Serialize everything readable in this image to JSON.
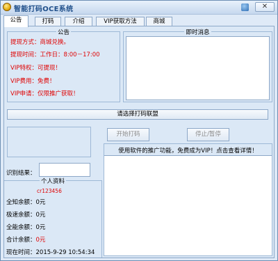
{
  "window": {
    "title": "智能打码OCE系统",
    "close_symbol": "✕"
  },
  "tabs": [
    "公告",
    "打码",
    "介绍",
    "VIP获取方法",
    "商城"
  ],
  "notice": {
    "title": "公告",
    "lines": [
      "提现方式：商城兑换。",
      "提现时间：工作日：8:00－17:00",
      "VIP特权：可提现！",
      "VIP费用：免费！",
      "VIP申请：仅限推广获取！"
    ]
  },
  "instant_messages": {
    "title": "即时消息"
  },
  "alliance_select": {
    "label": "请选择打码联盟"
  },
  "buttons": {
    "start": "开始打码",
    "stop": "停止/暂停"
  },
  "promo": {
    "text": "使用软件的推广功能，免费成为VIP！点击查看详情！"
  },
  "recognition": {
    "label": "识别结果：",
    "value": ""
  },
  "profile": {
    "title": "个人资料",
    "username": "cr123456",
    "rows": [
      {
        "label": "全知余额：",
        "value": "0元"
      },
      {
        "label": "极速余额：",
        "value": "0元"
      },
      {
        "label": "全能余额：",
        "value": "0元"
      },
      {
        "label": "合计余额：",
        "value": "0元"
      }
    ],
    "time_label": "现在时间：",
    "time_value": "2015-9-29  10:54:34"
  },
  "colors": {
    "accent_text": "#e00000",
    "title_text": "#1f4f8a",
    "background": "#dbe8f6"
  }
}
